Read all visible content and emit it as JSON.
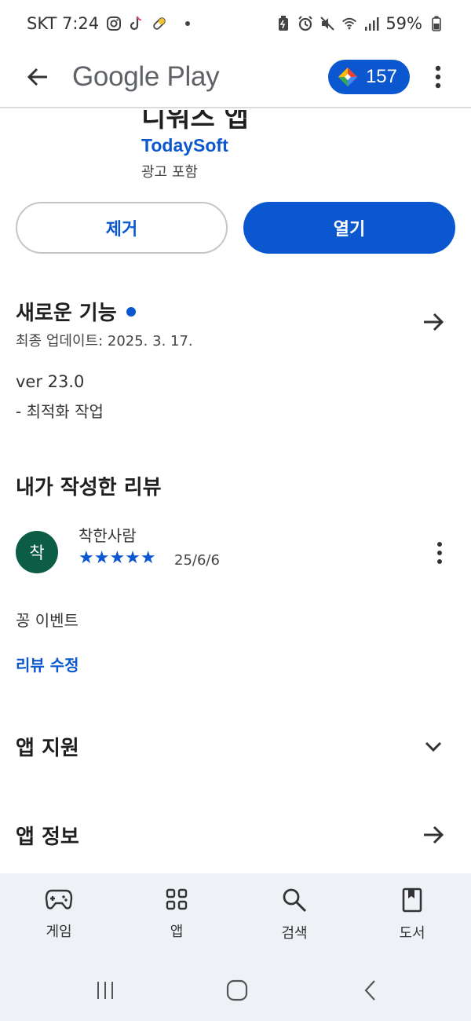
{
  "status_bar": {
    "carrier_time": "SKT 7:24",
    "battery": "59%",
    "left_icons": [
      "instagram-icon",
      "tiktok-icon",
      "pill-icon"
    ],
    "right_icons": [
      "battery-saver-icon",
      "alarm-icon",
      "mute-icon",
      "wifi-icon",
      "signal-icon",
      "battery-icon"
    ]
  },
  "app_bar": {
    "title": "Google Play",
    "points": "157"
  },
  "app": {
    "name_partial": "디워즈 앱",
    "developer": "TodaySoft",
    "ads_label": "광고 포함",
    "uninstall_label": "제거",
    "open_label": "열기"
  },
  "whats_new": {
    "title": "새로운 기능",
    "updated": "최종 업데이트: 2025. 3. 17.",
    "version": "ver 23.0",
    "notes": "- 최적화 작업"
  },
  "my_review": {
    "title": "내가 작성한 리뷰",
    "avatar_initial": "착",
    "reviewer": "착한사람",
    "stars": "★★★★★",
    "rating": 5,
    "date": "25/6/6",
    "text": "꽁 이벤트",
    "edit_label": "리뷰 수정"
  },
  "sections": {
    "app_support": "앱 지원",
    "app_info": "앱 정보"
  },
  "bottom_nav": [
    {
      "label": "게임",
      "icon": "gamepad-icon"
    },
    {
      "label": "앱",
      "icon": "apps-grid-icon"
    },
    {
      "label": "검색",
      "icon": "search-icon"
    },
    {
      "label": "도서",
      "icon": "book-icon"
    }
  ],
  "colors": {
    "accent": "#0b57d0",
    "avatar": "#0d5c45",
    "nav_bg": "#eef2f7"
  }
}
